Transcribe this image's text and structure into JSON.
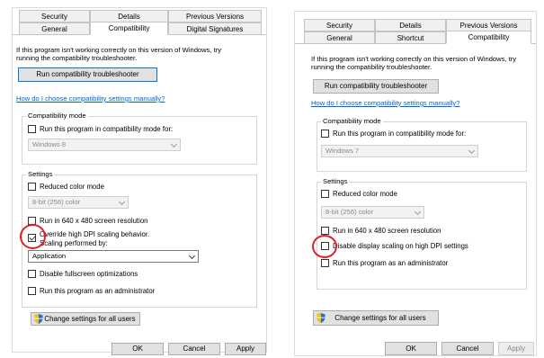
{
  "left": {
    "tabs_top": [
      "Security",
      "Details",
      "Previous Versions"
    ],
    "tabs_bottom": [
      "General",
      "Compatibility",
      "Digital Signatures"
    ],
    "intro": "If this program isn't working correctly on this version of Windows, try running the compatibility troubleshooter.",
    "troubleshooter_button": "Run compatibility troubleshooter",
    "manual_link": "How do I choose compatibility settings manually?",
    "compat_mode_title": "Compatibility mode",
    "compat_mode_checkbox": "Run this program in compatibility mode for:",
    "compat_mode_select": "Windows 8",
    "settings_title": "Settings",
    "reduced_color": "Reduced color mode",
    "color_select": "8-bit (256) color",
    "run_640": "Run in 640 x 480 screen resolution",
    "override_dpi": "Override high DPI scaling behavior.",
    "scaling_by": "Scaling performed by:",
    "scaling_select": "Application",
    "disable_fullscreen": "Disable fullscreen optimizations",
    "run_admin": "Run this program as an administrator",
    "change_all_users": "Change settings for all users",
    "ok": "OK",
    "cancel": "Cancel",
    "apply": "Apply"
  },
  "right": {
    "tabs_top": [
      "Security",
      "Details",
      "Previous Versions"
    ],
    "tabs_bottom": [
      "General",
      "Shortcut",
      "Compatibility"
    ],
    "intro": "If this program isn't working correctly on this version of Windows, try running the compatibility troubleshooter.",
    "troubleshooter_button": "Run compatibility troubleshooter",
    "manual_link": "How do I choose compatibility settings manually?",
    "compat_mode_title": "Compatibility mode",
    "compat_mode_checkbox": "Run this program in compatibility mode for:",
    "compat_mode_select": "Windows 7",
    "settings_title": "Settings",
    "reduced_color": "Reduced color mode",
    "color_select": "8-bit (256) color",
    "run_640": "Run in 640 x 480 screen resolution",
    "disable_dpi": "Disable display scaling on high DPI settings",
    "run_admin": "Run this program as an administrator",
    "change_all_users": "Change settings for all users",
    "ok": "OK",
    "cancel": "Cancel",
    "apply": "Apply"
  },
  "colors": {
    "highlight_circle": "#e0202a",
    "link": "#0066cc",
    "primary_border": "#0078d7"
  }
}
